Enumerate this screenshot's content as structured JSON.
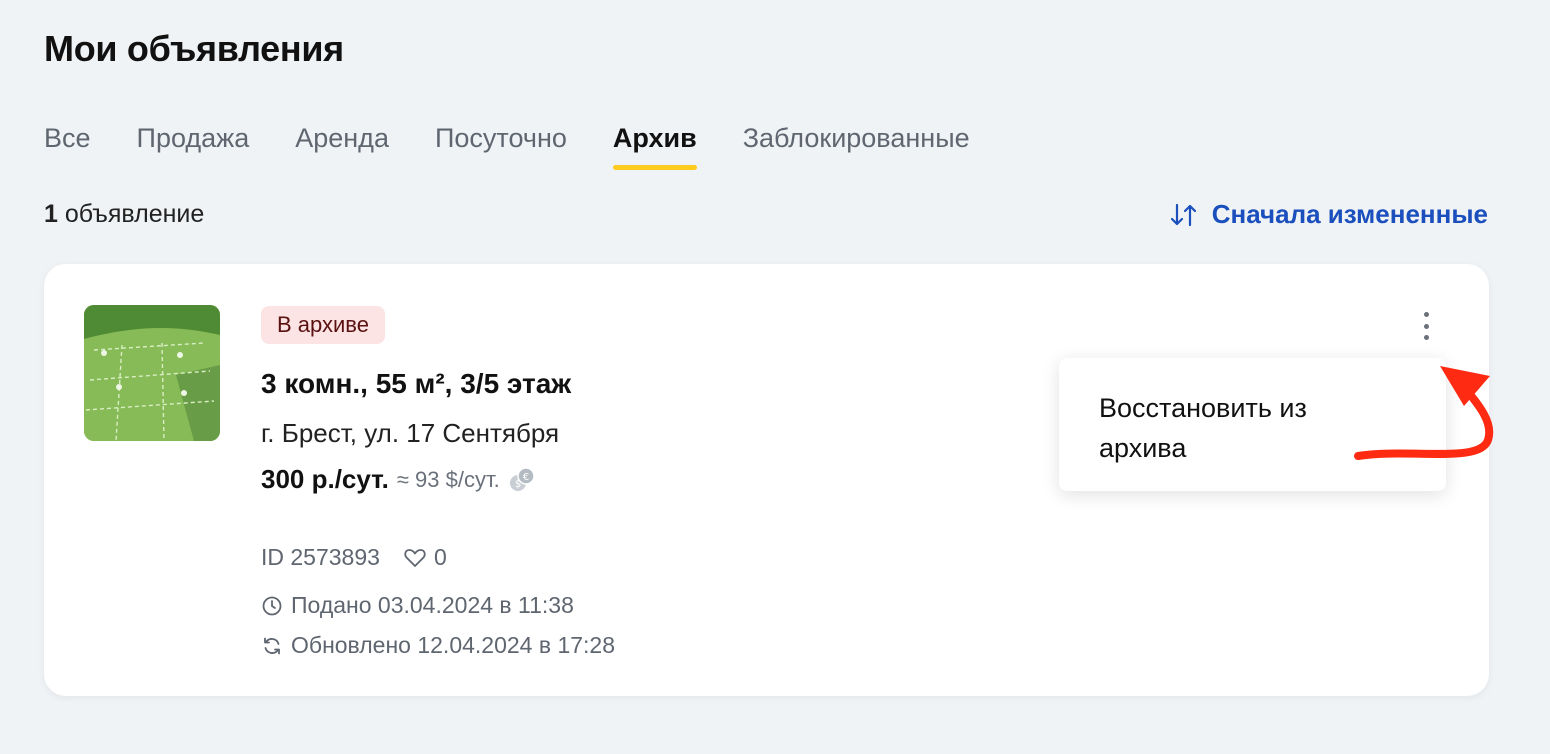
{
  "page": {
    "title": "Мои объявления"
  },
  "tabs": [
    {
      "label": "Все",
      "active": false
    },
    {
      "label": "Продажа",
      "active": false
    },
    {
      "label": "Аренда",
      "active": false
    },
    {
      "label": "Посуточно",
      "active": false
    },
    {
      "label": "Архив",
      "active": true
    },
    {
      "label": "Заблокированные",
      "active": false
    }
  ],
  "summary": {
    "count": "1",
    "count_label": "объявление"
  },
  "sort": {
    "label": "Сначала измененные",
    "icon": "sort-arrows-icon",
    "color": "#1a4fbd"
  },
  "listing": {
    "status_badge": "В архиве",
    "title": "3 комн., 55 м², 3/5 этаж",
    "address": "г. Брест, ул. 17 Сентября",
    "price": "300 р./сут.",
    "price_approx": "≈ 93 $/сут.",
    "id_text": "ID 2573893",
    "favorites_count": "0",
    "posted": "Подано 03.04.2024 в 11:38",
    "updated": "Обновлено 12.04.2024 в 17:28"
  },
  "context_menu": {
    "items": [
      {
        "label": "Восстановить из архива"
      }
    ]
  },
  "colors": {
    "background": "#f0f3f6",
    "active_tab_underline": "#ffcb1f",
    "badge_bg": "#fde4e4",
    "annotation_arrow": "#ff2a12"
  }
}
